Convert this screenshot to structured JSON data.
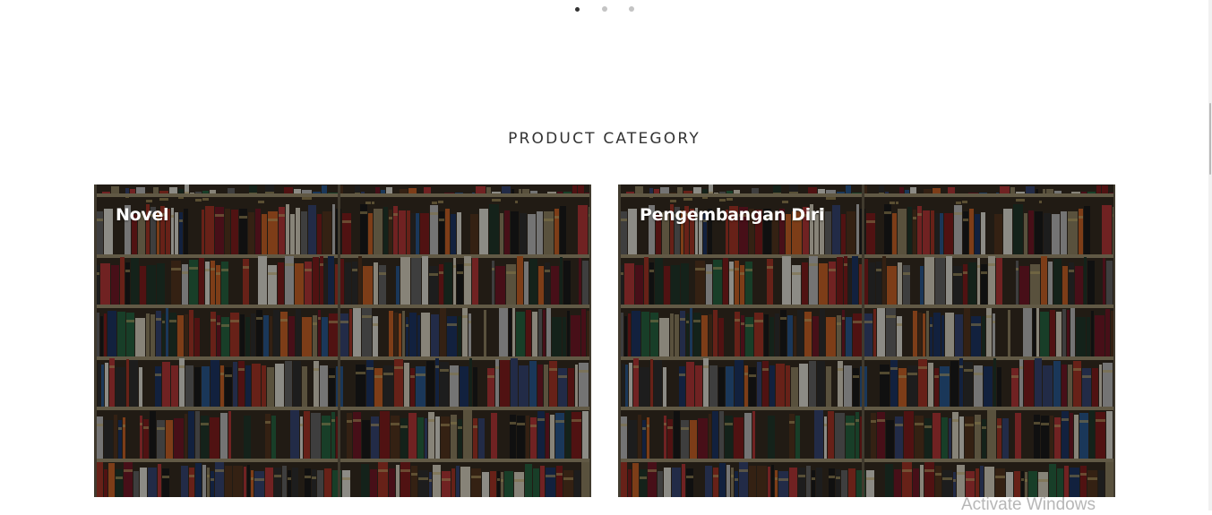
{
  "carousel": {
    "slide_count": 3,
    "active_index": 0
  },
  "section": {
    "title": "PRODUCT CATEGORY"
  },
  "categories": [
    {
      "label": "Novel"
    },
    {
      "label": "Pengembangan Diri"
    }
  ],
  "watermark": {
    "text": "Activate Windows"
  },
  "colors": {
    "book_palette": [
      "#8a1f1f",
      "#b23a2a",
      "#c9c9c9",
      "#e8e2cf",
      "#1f3a6b",
      "#2e5f9a",
      "#1d1d1d",
      "#333333",
      "#5a3a22",
      "#2a6b45",
      "#d86a2a",
      "#6b6b6b",
      "#f2f0e6",
      "#3b4a7a",
      "#9a8c6a",
      "#c23b3b",
      "#243b2e",
      "#7a1b2a"
    ]
  }
}
